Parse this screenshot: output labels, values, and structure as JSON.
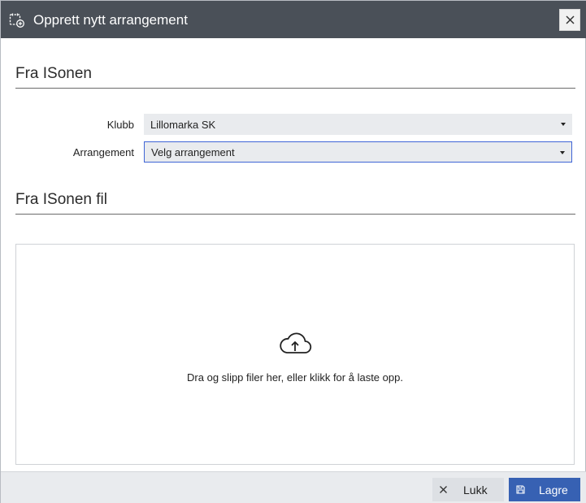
{
  "dialog": {
    "title": "Opprett nytt arrangement",
    "title_icon": "calendar-add-icon",
    "close_icon": "close-icon"
  },
  "section_isonen": {
    "heading": "Fra ISonen",
    "fields": {
      "klubb_label": "Klubb",
      "klubb_value": "Lillomarka SK",
      "arrangement_label": "Arrangement",
      "arrangement_value": "Velg arrangement"
    }
  },
  "section_file": {
    "heading": "Fra ISonen fil",
    "dropzone_icon": "cloud-upload-icon",
    "dropzone_text": "Dra og slipp filer her, eller klikk for å laste opp."
  },
  "footer": {
    "close_label": "Lukk",
    "close_icon": "close-icon",
    "save_label": "Lagre",
    "save_icon": "save-icon"
  },
  "colors": {
    "titlebar": "#4a5058",
    "primary": "#3761b3",
    "focus_border": "#3f65d6",
    "input_bg": "#e9ebee"
  }
}
